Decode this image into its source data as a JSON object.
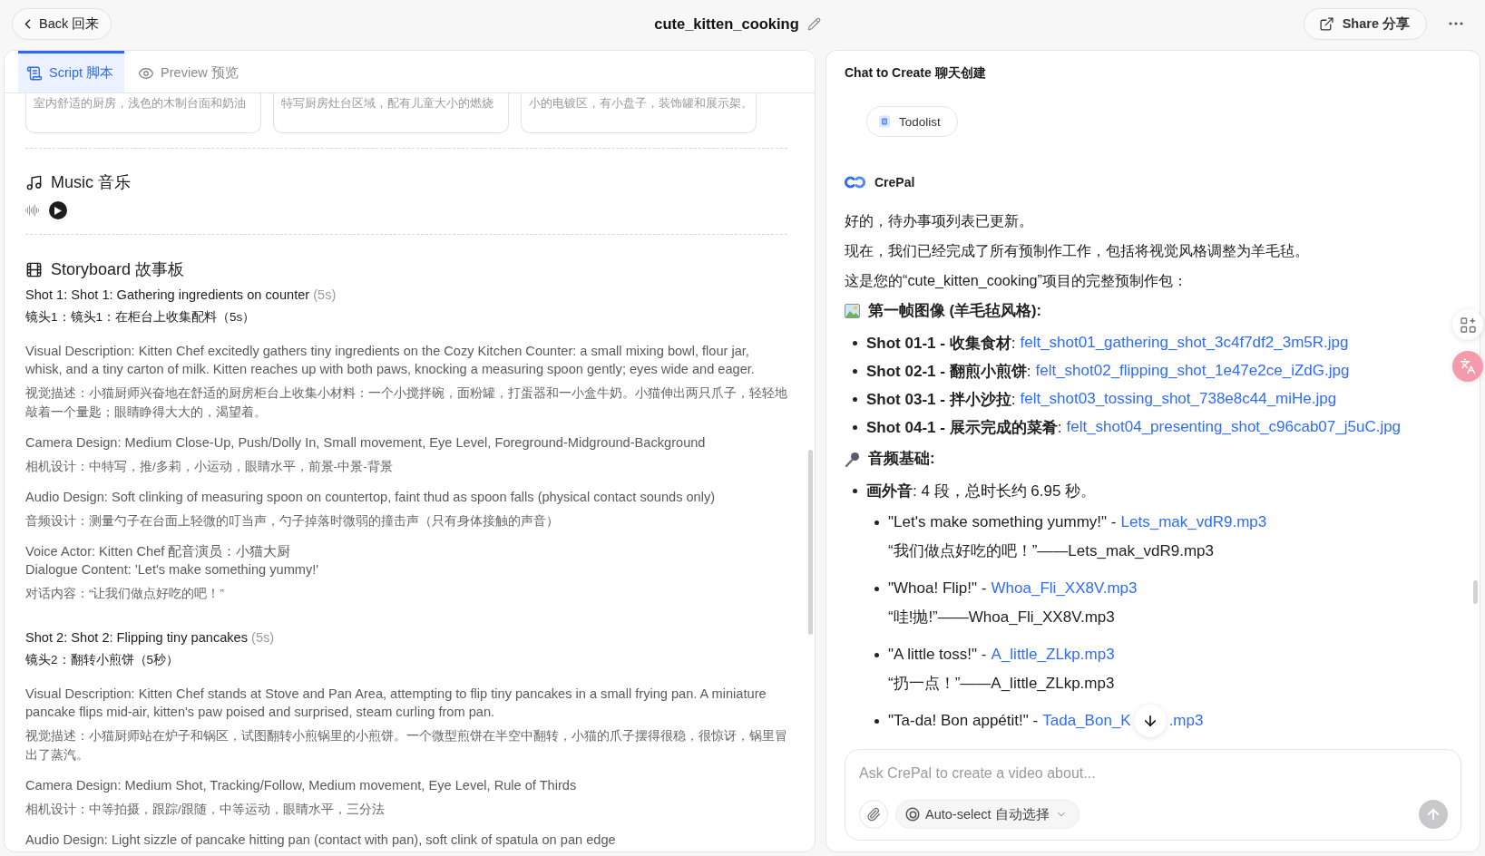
{
  "header": {
    "back": "Back 回来",
    "title": "cute_kitten_cooking",
    "share": "Share 分享"
  },
  "script_panel": {
    "tabs": [
      {
        "kind": "script",
        "label": "Script 脚本",
        "selected": true
      },
      {
        "kind": "preview",
        "label": "Preview 预览",
        "selected": false
      }
    ],
    "scene_cards": [
      "室内舒适的厨房，浅色的木制台面和奶油",
      "特写厨房灶台区域，配有儿童大小的燃烧",
      "小的电镀区，有小盘子，装饰罐和展示架。"
    ],
    "music": {
      "heading": "Music 音乐"
    },
    "storyboard": {
      "heading": "Storyboard 故事板",
      "shots": [
        {
          "title": "Shot 1: Shot 1: Gathering ingredients on counter",
          "duration": "(5s)",
          "title_zh": "镜头1：镜头1：在柜台上收集配料（5s）",
          "sections": [
            {
              "lines_en": [
                "Visual Description: Kitten Chef excitedly gathers tiny ingredients on the Cozy Kitchen Counter: a small mixing bowl, flour jar, whisk, and a tiny carton of milk. Kitten reaches up with both paws, knocking a measuring spoon gently; eyes wide and eager."
              ],
              "line_zh": "视觉描述：小猫厨师兴奋地在舒适的厨房柜台上收集小材料：一个小搅拌碗，面粉罐，打蛋器和一小盒牛奶。小猫伸出两只爪子，轻轻地敲着一个量匙；眼睛睁得大大的，渴望着。"
            },
            {
              "lines_en": [
                "Camera Design: Medium Close-Up, Push/Dolly In, Small movement, Eye Level, Foreground-Midground-Background"
              ],
              "line_zh": "相机设计：中特写，推/多莉，小运动，眼睛水平，前景-中景-背景"
            },
            {
              "lines_en": [
                "Audio Design: Soft clinking of measuring spoon on countertop, faint thud as spoon falls (physical contact sounds only)"
              ],
              "line_zh": "音频设计：测量勺子在台面上轻微的叮当声，勺子掉落时微弱的撞击声（只有身体接触的声音）"
            },
            {
              "lines_en": [
                "Voice Actor: Kitten Chef 配音演员：小猫大厨",
                "Dialogue Content: 'Let's make something yummy!'"
              ],
              "line_zh": "对话内容：“让我们做点好吃的吧！”"
            }
          ]
        },
        {
          "title": "Shot 2: Shot 2: Flipping tiny pancakes",
          "duration": "(5s)",
          "title_zh": "镜头2：翻转小煎饼（5秒）",
          "sections": [
            {
              "lines_en": [
                "Visual Description: Kitten Chef stands at Stove and Pan Area, attempting to flip tiny pancakes in a small frying pan. A miniature pancake flips mid-air, kitten's paw poised and surprised, steam curling from pan."
              ],
              "line_zh": "视觉描述：小猫厨师站在炉子和锅区，试图翻转小煎锅里的小煎饼。一个微型煎饼在半空中翻转，小猫的爪子摆得很稳，很惊讶，锅里冒出了蒸汽。"
            },
            {
              "lines_en": [
                "Camera Design: Medium Shot, Tracking/Follow, Medium movement, Eye Level, Rule of Thirds"
              ],
              "line_zh": "相机设计：中等拍摄，跟踪/跟随，中等运动，眼睛水平，三分法"
            },
            {
              "lines_en": [
                "Audio Design: Light sizzle of pancake hitting pan (contact with pan), soft clink of spatula on pan edge"
              ]
            }
          ]
        }
      ]
    }
  },
  "chat_panel": {
    "title": "Chat to Create 聊天创建",
    "todolist": "Todolist",
    "assistant": "CrePal",
    "messages": [
      {
        "kind": "paragraph",
        "text": "好的，待办事项列表已更新。"
      },
      {
        "kind": "paragraph",
        "text": "现在，我们已经完成了所有预制作工作，包括将视觉风格调整为羊毛毡。"
      },
      {
        "kind": "paragraph",
        "text": "这是您的“cute_kitten_cooking”项目的完整预制作包："
      },
      {
        "kind": "heading",
        "text": "第一帧图像 (羊毛毡风格):"
      },
      {
        "kind": "list",
        "items": [
          {
            "text": "**Shot 01-1 - 收集食材**:",
            "link": "felt_shot01_gathering_shot_3c4f7df2_3m5R.jpg"
          },
          {
            "text": "**Shot 02-1 - 翻煎小煎饼**:",
            "link": "felt_shot02_flipping_shot_1e47e2ce_iZdG.jpg"
          },
          {
            "text": "**Shot 03-1 - 拌小沙拉**:",
            "link": "felt_shot03_tossing_shot_738e8c44_miHe.jpg"
          },
          {
            "text": "**Shot 04-1 - 展示完成的菜肴**:",
            "link": "felt_shot04_presenting_shot_c96cab07_j5uC.jpg"
          }
        ]
      },
      {
        "kind": "heading",
        "text": "音频基础:"
      },
      {
        "kind": "list",
        "items": [
          {
            "text": "**画外音**: 4 段，总时长约 6.95 秒。",
            "children": [
              {
                "text": "\"Let's make something yummy!\" -",
                "link": "Lets_mak_vdR9.mp3",
                "note": "“我们做点好吃的吧！”——Lets_mak_vdR9.mp3"
              },
              {
                "text": "\"Whoa! Flip!\" -",
                "link": "Whoa_Fli_XX8V.mp3",
                "note": "“哇!抛!”——Whoa_Fli_XX8V.mp3"
              },
              {
                "text": "\"A little toss!\" -",
                "link": "A_little_ZLkp.mp3",
                "note": "“扔一点！”——A_little_ZLkp.mp3"
              },
              {
                "text": "\"Ta-da! Bon appétit!\" -",
                "link_parts": [
                  "Tada_Bon_K",
                  ".mp3"
                ]
              }
            ]
          }
        ]
      }
    ],
    "input": {
      "placeholder": "Ask CrePal to create a video about...",
      "model": "Auto-select 自动选择"
    }
  }
}
